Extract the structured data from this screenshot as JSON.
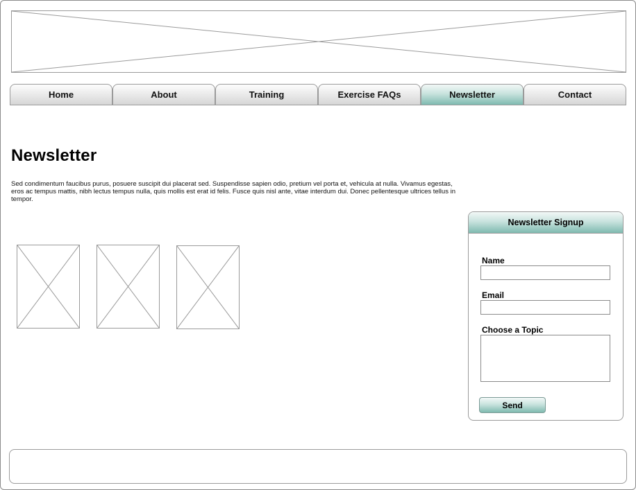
{
  "nav": {
    "tabs": [
      {
        "label": "Home",
        "active": false
      },
      {
        "label": "About",
        "active": false
      },
      {
        "label": "Training",
        "active": false
      },
      {
        "label": "Exercise FAQs",
        "active": false
      },
      {
        "label": "Newsletter",
        "active": true
      },
      {
        "label": "Contact",
        "active": false
      }
    ]
  },
  "main": {
    "title": "Newsletter",
    "intro": "Sed condimentum faucibus purus, posuere suscipit dui placerat sed. Suspendisse sapien odio, pretium vel porta et, vehicula at nulla. Vivamus egestas, eros ac tempus mattis, nibh lectus tempus nulla, quis mollis est erat id felis. Fusce quis nisl ante, vitae interdum dui. Donec pellentesque ultrices tellus in tempor."
  },
  "signup": {
    "title": "Newsletter Signup",
    "name_label": "Name",
    "name_value": "",
    "email_label": "Email",
    "email_value": "",
    "topic_label": "Choose a Topic",
    "topic_value": "",
    "send_label": "Send"
  },
  "colors": {
    "accent_teal": "#7fbab0",
    "border_gray": "#9a9a9a",
    "tab_gray": "#d6d6d6"
  }
}
